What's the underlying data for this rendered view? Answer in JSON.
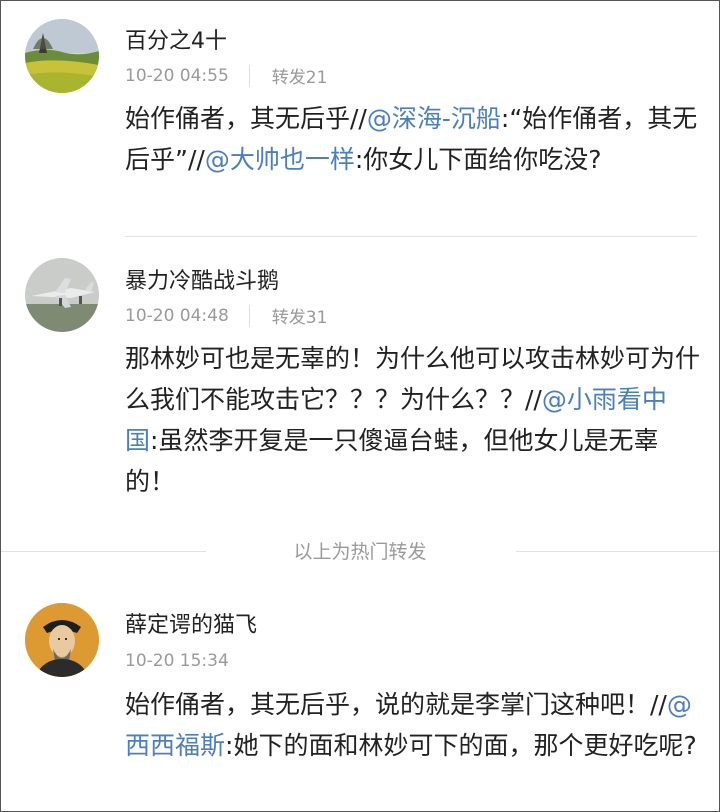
{
  "comments": [
    {
      "author": "百分之4十",
      "time": "10-20 04:55",
      "reposts": "转发21",
      "text": [
        {
          "t": "始作俑者，其无后乎//"
        },
        {
          "t": "@深海-沉船",
          "mention": true
        },
        {
          "t": ":“始作俑者，其无后乎”//"
        },
        {
          "t": "@大帅也一样",
          "mention": true
        },
        {
          "t": ":你女儿下面给你吃没?"
        }
      ]
    },
    {
      "author": "暴力冷酷战斗鹅",
      "time": "10-20 04:48",
      "reposts": "转发31",
      "text": [
        {
          "t": "那林妙可也是无辜的！为什么他可以攻击林妙可为什么我们不能攻击它？？？为什么？？//"
        },
        {
          "t": "@小雨看中国",
          "mention": true
        },
        {
          "t": ":虽然李开复是一只傻逼台蛙，但他女儿是无辜的！"
        }
      ]
    },
    {
      "author": "薛定谔的猫飞",
      "time": "10-20 15:34",
      "text": [
        {
          "t": "始作俑者，其无后乎，说的就是李掌门这种吧！//"
        },
        {
          "t": "@西西福斯",
          "mention": true
        },
        {
          "t": ":她下的面和林妙可下的面，那个更好吃呢?"
        }
      ]
    }
  ],
  "hot_separator_label": "以上为热门转发",
  "colors": {
    "mention": "#4b7fbf",
    "meta": "#9a9a9a",
    "text": "#222222"
  },
  "icons": [
    "landscape-avatar-icon",
    "aircraft-avatar-icon",
    "portrait-avatar-icon"
  ]
}
